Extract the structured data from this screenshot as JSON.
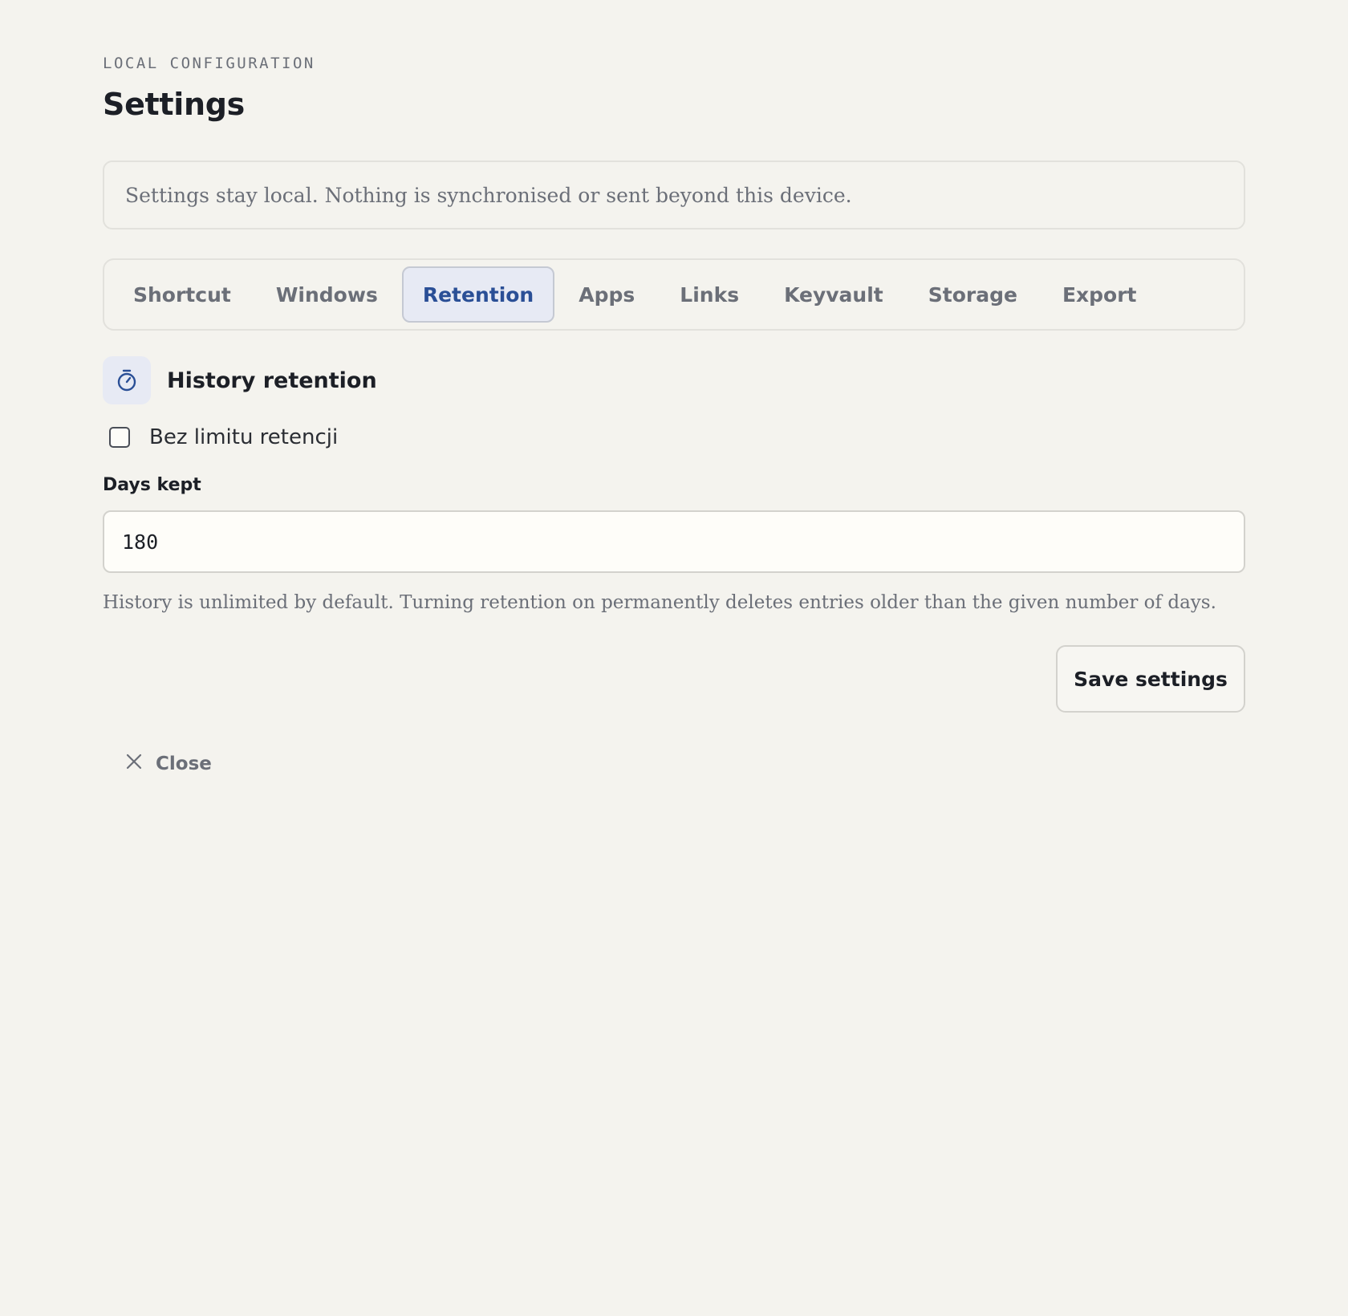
{
  "header": {
    "eyebrow": "LOCAL CONFIGURATION",
    "title": "Settings"
  },
  "notice": {
    "text": "Settings stay local. Nothing is synchronised or sent beyond this device."
  },
  "tabs": [
    {
      "label": "Shortcut",
      "active": false
    },
    {
      "label": "Windows",
      "active": false
    },
    {
      "label": "Retention",
      "active": true
    },
    {
      "label": "Apps",
      "active": false
    },
    {
      "label": "Links",
      "active": false
    },
    {
      "label": "Keyvault",
      "active": false
    },
    {
      "label": "Storage",
      "active": false
    },
    {
      "label": "Export",
      "active": false
    }
  ],
  "section": {
    "icon": "stopwatch-icon",
    "title": "History retention"
  },
  "retention": {
    "unlimited_label": "Bez limitu retencji",
    "unlimited_checked": false,
    "days_label": "Days kept",
    "days_value": "180",
    "help": "History is unlimited by default. Turning retention on permanently deletes entries older than the given number of days."
  },
  "actions": {
    "save_label": "Save settings",
    "close_label": "Close"
  },
  "colors": {
    "background": "#f4f3ee",
    "accent": "#2a4f96",
    "accent_bg": "#e7eaf4",
    "muted_text": "#6b6f78"
  }
}
